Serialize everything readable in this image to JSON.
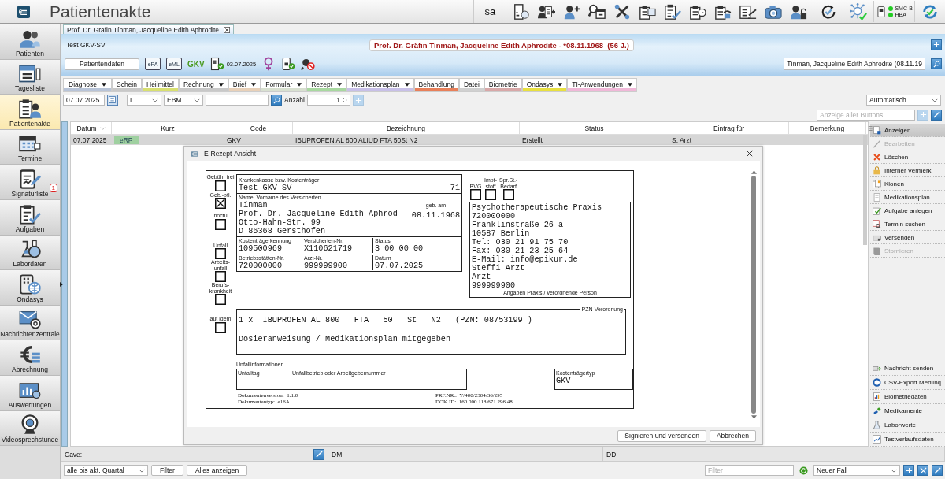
{
  "app": {
    "title": "Patientenakte",
    "user": "sa"
  },
  "status_lights": [
    {
      "label": "SMC-B",
      "on": true
    },
    {
      "label": "HBA",
      "on": true
    }
  ],
  "sidebar": {
    "items": [
      {
        "label": "Patienten",
        "selected": false
      },
      {
        "label": "Tagesliste",
        "selected": false
      },
      {
        "label": "Patientenakte",
        "selected": true
      },
      {
        "label": "Termine",
        "selected": false
      },
      {
        "label": "Signaturliste",
        "selected": false,
        "badge": "1"
      },
      {
        "label": "Aufgaben",
        "selected": false
      },
      {
        "label": "Labordaten",
        "selected": false
      },
      {
        "label": "Ondasys",
        "selected": false
      },
      {
        "label": "Nachrichtenzentrale",
        "selected": false
      },
      {
        "label": "Abrechnung",
        "selected": false
      },
      {
        "label": "Auswertungen",
        "selected": false
      },
      {
        "label": "Videosprechstunde",
        "selected": false
      }
    ]
  },
  "document_tab": {
    "label": "Prof. Dr. Gräfin Tínman, Jacqueline Edith Aphrodite"
  },
  "header": {
    "insurance": "Test GKV-SV",
    "banner": "Prof. Dr. Gräfin Tínman, Jacqueline Edith Aphrodite - *08.11.1968  (56 J.)",
    "patient_data_button": "Patientendaten",
    "epa": "ePA",
    "eml": "eML",
    "insurance_type": "GKV",
    "card_date": "03.07.2025",
    "patient_search": "Tínman, Jacqueline Edith Aphrodite (08.11.19"
  },
  "menu": [
    {
      "label": "Diagnose",
      "dropdown": true,
      "color": "#b8c4d8"
    },
    {
      "label": "Schein",
      "dropdown": false,
      "color": "#c8c8c8"
    },
    {
      "label": "Heilmittel",
      "dropdown": false,
      "color": "#d8e070"
    },
    {
      "label": "Rechnung",
      "dropdown": true,
      "color": "#c8c8c8"
    },
    {
      "label": "Brief",
      "dropdown": true,
      "color": "#e8d0b8"
    },
    {
      "label": "Formular",
      "dropdown": true,
      "color": "#d8e0d0"
    },
    {
      "label": "Rezept",
      "dropdown": true,
      "color": "#a8d8a0"
    },
    {
      "label": "Medikationsplan",
      "dropdown": true,
      "color": "#c8c0e8"
    },
    {
      "label": "Behandlung",
      "dropdown": false,
      "color": "#e8805a"
    },
    {
      "label": "Datei",
      "dropdown": false,
      "color": "#d0d0d0"
    },
    {
      "label": "Biometrie",
      "dropdown": false,
      "color": "#d8a8a8"
    },
    {
      "label": "Ondasys",
      "dropdown": true,
      "color": "#e8e040"
    },
    {
      "label": "TI-Anwendungen",
      "dropdown": true,
      "color": "#f0b8d8"
    }
  ],
  "filter": {
    "date": "07.07.2025",
    "type": "L",
    "catalog": "EBM",
    "count_label": "Anzahl",
    "count": "1",
    "view": "Automatisch",
    "buttons_placeholder": "Anzeige aller Buttons"
  },
  "table": {
    "columns": [
      "Datum",
      "Kurz",
      "Code",
      "Bezeichnung",
      "Status",
      "Eintrag für",
      "Bemerkung"
    ],
    "rows": [
      {
        "date": "07.07.2025",
        "short": "eRP",
        "code": "GKV",
        "description": "IBUPROFEN AL 800 ALIUD FTA 50St N2",
        "status": "Erstellt",
        "entry_for": "S. Arzt",
        "selected": true
      }
    ]
  },
  "actions": [
    {
      "label": "Anzeigen",
      "selected": true,
      "disabled": false
    },
    {
      "label": "Bearbeiten",
      "selected": false,
      "disabled": true
    },
    {
      "label": "Löschen",
      "selected": false,
      "disabled": false
    },
    {
      "label": "Interner Vermerk",
      "selected": false,
      "disabled": false
    },
    {
      "label": "Klonen",
      "selected": false,
      "disabled": false
    },
    {
      "label": "Medikationsplan",
      "selected": false,
      "disabled": false
    },
    {
      "label": "Aufgabe anlegen",
      "selected": false,
      "disabled": false
    },
    {
      "label": "Termin suchen",
      "selected": false,
      "disabled": false
    },
    {
      "label": "Versenden",
      "selected": false,
      "disabled": false
    },
    {
      "label": "Stornieren",
      "selected": false,
      "disabled": true
    }
  ],
  "extra_actions": [
    "Nachricht senden",
    "CSV-Export Medlinq",
    "Biometriedaten",
    "Medikamente",
    "Laborwerte",
    "Testverlaufsdaten"
  ],
  "dialog": {
    "title": "E-Rezept-Ansicht",
    "left_checkboxes": [
      {
        "label": "Gebühr frei",
        "checked": false
      },
      {
        "label": "Geb.-pfl.",
        "checked": true
      },
      {
        "label": "noctu",
        "checked": false
      },
      {
        "label": "Unfall",
        "checked": false
      },
      {
        "label": "Arbeits-unfall",
        "checked": false
      },
      {
        "label": "Berufs-krankheit",
        "checked": false
      },
      {
        "label": "aut idem",
        "checked": false
      }
    ],
    "top_checkboxes": [
      {
        "label": "BVG",
        "checked": false
      },
      {
        "label": "Impf-stoff",
        "checked": false
      },
      {
        "label": "Spr.St.-Bedarf",
        "checked": false
      }
    ],
    "insurer_label": "Krankenkasse bzw. Kostenträger",
    "insurer": "Test GKV-SV",
    "insurer_code": "71",
    "name_label": "Name, Vorname des Versicherten",
    "birth_label": "geb. am",
    "patient_lines": [
      "Tínman",
      "Prof. Dr. Jacqueline Edith Aphrod",
      "Otto-Hahn-Str. 99",
      "D 86368 Gersthofen"
    ],
    "birth_date": "08.11.1968",
    "ids": [
      [
        {
          "label": "Kostenträgerkennung",
          "value": "109500969"
        },
        {
          "label": "Versicherten-Nr.",
          "value": "X110621719"
        },
        {
          "label": "Status",
          "value": "3 00 00 00"
        }
      ],
      [
        {
          "label": "Betriebsstätten-Nr.",
          "value": "720000000"
        },
        {
          "label": "Arzt-Nr.",
          "value": "999999900"
        },
        {
          "label": "Datum",
          "value": "07.07.2025"
        }
      ]
    ],
    "practice_lines": [
      "Psychotherapeutische Praxis",
      "720000000",
      "Franklinstraße 26 a",
      "10587  Berlin",
      "Tel: 030 21 91 75 70",
      "Fax: 030 21 23 25 64",
      "E-Mail: info@epikur.de",
      "Steffi Arzt",
      "Arzt",
      "999999900"
    ],
    "practice_caption": "Angaben Praxis / verordnende Person",
    "pzn_label": "PZN-Verordnung",
    "prescription": "1 x  IBUPROFEN AL 800   FTA   50   St   N2   (PZN: 08753199 )",
    "dosage": "Dosieranweisung / Medikationsplan mitgegeben",
    "accident_label": "Unfallinformationen",
    "accident_day_label": "Unfalltag",
    "accident_company_label": "Unfallbetrieb oder Arbeitgebernummer",
    "payer_type_label": "Kostenträgertyp",
    "payer_type": "GKV",
    "meta_left": [
      "Dokumentenversion:  1.1.0",
      "Dokumententyp:  e16A"
    ],
    "meta_right": [
      "PRF.NR.:  Y/400/2304/36/295",
      "DOK.ID:  160.000.113.671.296.48"
    ],
    "buttons": [
      "Signieren und versenden",
      "Abbrechen"
    ]
  },
  "info_bar": {
    "cave": "Cave:",
    "dm": "DM:",
    "dd": "DD:"
  },
  "footer": {
    "period": "alle bis akt. Quartal",
    "filter_button": "Filter",
    "show_all_button": "Alles anzeigen",
    "filter_placeholder": "Filter",
    "case": "Neuer Fall"
  }
}
